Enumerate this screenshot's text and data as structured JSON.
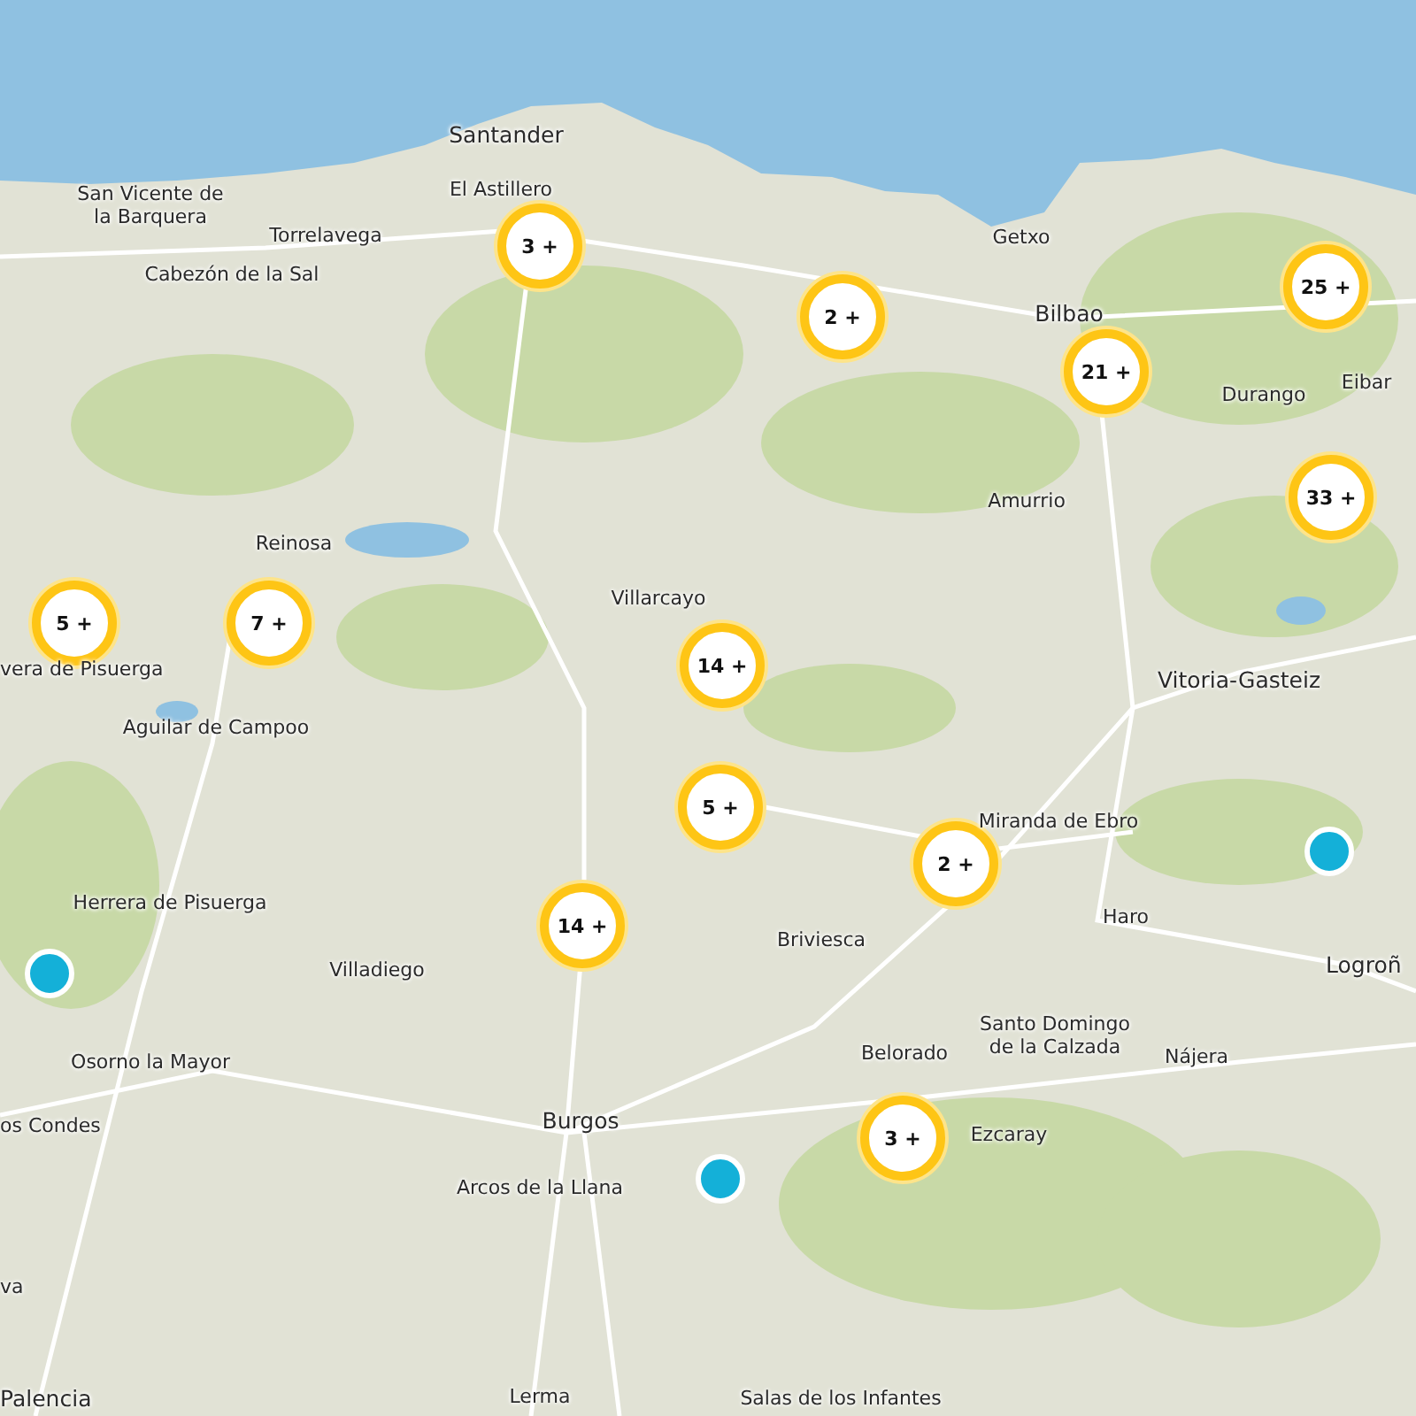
{
  "places": [
    {
      "name": "Santander",
      "kind": "city"
    },
    {
      "name": "El Astillero",
      "kind": "town"
    },
    {
      "name": "San Vicente de\nla Barquera",
      "kind": "town"
    },
    {
      "name": "Torrelavega",
      "kind": "town"
    },
    {
      "name": "Cabezón de la Sal",
      "kind": "town"
    },
    {
      "name": "Getxo",
      "kind": "town"
    },
    {
      "name": "Bilbao",
      "kind": "city"
    },
    {
      "name": "Durango",
      "kind": "town"
    },
    {
      "name": "Eibar",
      "kind": "town"
    },
    {
      "name": "Amurrio",
      "kind": "town"
    },
    {
      "name": "Reinosa",
      "kind": "town"
    },
    {
      "name": "Villarcayo",
      "kind": "town"
    },
    {
      "name": "vera de Pisuerga",
      "kind": "town"
    },
    {
      "name": "Aguilar de Campoo",
      "kind": "town"
    },
    {
      "name": "Vitoria-Gasteiz",
      "kind": "city"
    },
    {
      "name": "Miranda de Ebro",
      "kind": "town"
    },
    {
      "name": "Haro",
      "kind": "town"
    },
    {
      "name": "Logroñ",
      "kind": "city"
    },
    {
      "name": "Herrera de Pisuerga",
      "kind": "town"
    },
    {
      "name": "Villadiego",
      "kind": "town"
    },
    {
      "name": "Briviesca",
      "kind": "town"
    },
    {
      "name": "Osorno la Mayor",
      "kind": "town"
    },
    {
      "name": "Belorado",
      "kind": "town"
    },
    {
      "name": "Santo Domingo\nde la Calzada",
      "kind": "town"
    },
    {
      "name": "Nájera",
      "kind": "town"
    },
    {
      "name": "os Condes",
      "kind": "town"
    },
    {
      "name": "Burgos",
      "kind": "city"
    },
    {
      "name": "Ezcaray",
      "kind": "town"
    },
    {
      "name": "Arcos de la Llana",
      "kind": "town"
    },
    {
      "name": "va",
      "kind": "town"
    },
    {
      "name": "Palencia",
      "kind": "city"
    },
    {
      "name": "Lerma",
      "kind": "town"
    },
    {
      "name": "Salas de los Infantes",
      "kind": "town"
    }
  ],
  "markers": [
    {
      "kind": "cluster",
      "count": "3 +"
    },
    {
      "kind": "cluster",
      "count": "2 +"
    },
    {
      "kind": "cluster",
      "count": "25 +"
    },
    {
      "kind": "cluster",
      "count": "21 +"
    },
    {
      "kind": "cluster",
      "count": "33 +"
    },
    {
      "kind": "cluster",
      "count": "5 +"
    },
    {
      "kind": "cluster",
      "count": "7 +"
    },
    {
      "kind": "cluster",
      "count": "14 +"
    },
    {
      "kind": "cluster",
      "count": "5 +"
    },
    {
      "kind": "cluster",
      "count": "2 +"
    },
    {
      "kind": "cluster",
      "count": "14 +"
    },
    {
      "kind": "cluster",
      "count": "3 +"
    },
    {
      "kind": "point"
    },
    {
      "kind": "point"
    },
    {
      "kind": "point"
    }
  ]
}
